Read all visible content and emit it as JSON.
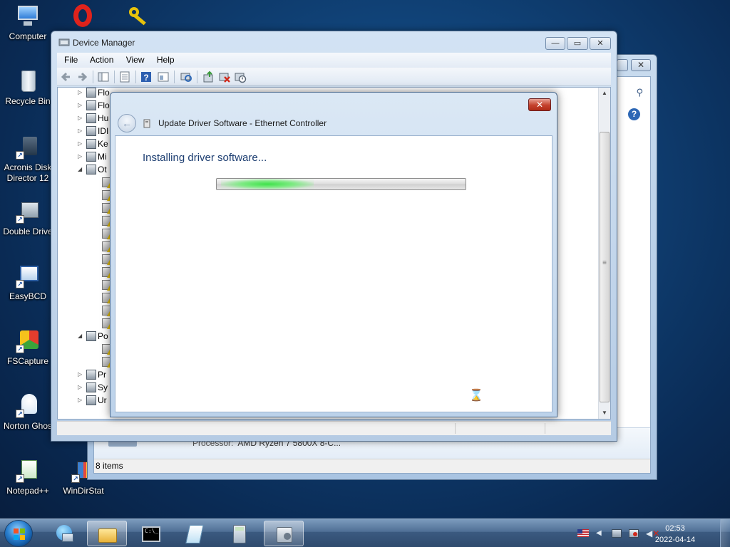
{
  "desktop": {
    "icons": [
      {
        "label": "Computer",
        "icon": "computer-icon"
      },
      {
        "label": "Opera",
        "icon": "opera-icon"
      },
      {
        "label": "",
        "icon": "key-icon"
      },
      {
        "label": "Recycle Bin",
        "icon": "recycle-bin-icon"
      },
      {
        "label": "Acronis Disk Director 12",
        "icon": "acronis-icon"
      },
      {
        "label": "Double Drive",
        "icon": "double-driver-icon"
      },
      {
        "label": "EasyBCD",
        "icon": "easybcd-icon"
      },
      {
        "label": "FSCapture",
        "icon": "fscapture-icon"
      },
      {
        "label": "Norton Ghos",
        "icon": "norton-ghost-icon"
      },
      {
        "label": "Notepad++",
        "icon": "notepadpp-icon"
      },
      {
        "label": "WinDirStat",
        "icon": "windirstat-icon"
      }
    ]
  },
  "explorer_back": {
    "processor_label": "Processor:",
    "processor_value": "AMD Ryzen 7 5800X 8-C...",
    "status": "8 items"
  },
  "device_manager": {
    "title": "Device Manager",
    "menu": [
      "File",
      "Action",
      "View",
      "Help"
    ],
    "toolbar_icons": [
      "back-icon",
      "forward-icon",
      "show-hide-tree-icon",
      "properties-icon",
      "help-icon",
      "view-icon",
      "scan-hardware-icon",
      "update-driver-icon",
      "uninstall-icon",
      "disable-icon"
    ],
    "tree": [
      {
        "text": "Flo",
        "expander": "▷",
        "level": 0
      },
      {
        "text": "Flo",
        "expander": "▷",
        "level": 0
      },
      {
        "text": "Hu",
        "expander": "▷",
        "level": 0
      },
      {
        "text": "IDI",
        "expander": "▷",
        "level": 0
      },
      {
        "text": "Ke",
        "expander": "▷",
        "level": 0
      },
      {
        "text": "Mi",
        "expander": "▷",
        "level": 0
      },
      {
        "text": "Ot",
        "expander": "◢",
        "level": 0
      },
      {
        "text": "",
        "expander": "",
        "level": 1
      },
      {
        "text": "",
        "expander": "",
        "level": 1
      },
      {
        "text": "",
        "expander": "",
        "level": 1
      },
      {
        "text": "",
        "expander": "",
        "level": 1
      },
      {
        "text": "",
        "expander": "",
        "level": 1
      },
      {
        "text": "",
        "expander": "",
        "level": 1
      },
      {
        "text": "",
        "expander": "",
        "level": 1
      },
      {
        "text": "",
        "expander": "",
        "level": 1
      },
      {
        "text": "",
        "expander": "",
        "level": 1
      },
      {
        "text": "",
        "expander": "",
        "level": 1
      },
      {
        "text": "",
        "expander": "",
        "level": 1
      },
      {
        "text": "",
        "expander": "",
        "level": 1
      },
      {
        "text": "Po",
        "expander": "◢",
        "level": 0
      },
      {
        "text": "",
        "expander": "",
        "level": 1
      },
      {
        "text": "",
        "expander": "",
        "level": 1
      },
      {
        "text": "Pr",
        "expander": "▷",
        "level": 0
      },
      {
        "text": "Sy",
        "expander": "▷",
        "level": 0
      },
      {
        "text": "Ur",
        "expander": "▷",
        "level": 0
      }
    ]
  },
  "update_driver": {
    "title": "Update Driver Software - Ethernet Controller",
    "heading": "Installing driver software...",
    "progress_indeterminate": true,
    "close_label": "✕"
  },
  "taskbar": {
    "pinned": [
      "explorer-icon",
      "network-icon",
      "folder-icon",
      "cmd-icon",
      "notepad-icon",
      "calculator-icon",
      "device-manager-icon"
    ],
    "active_index": 6,
    "clock_time": "02:53",
    "clock_date": "2022-04-14",
    "tray_icons": [
      "language-flag-icon",
      "tray-arrow-icon",
      "safely-remove-icon",
      "network-tray-icon",
      "volume-muted-icon"
    ]
  },
  "colors": {
    "accent": "#1e3f72",
    "progress_green": "#3ee24a",
    "close_red": "#c4412c"
  }
}
